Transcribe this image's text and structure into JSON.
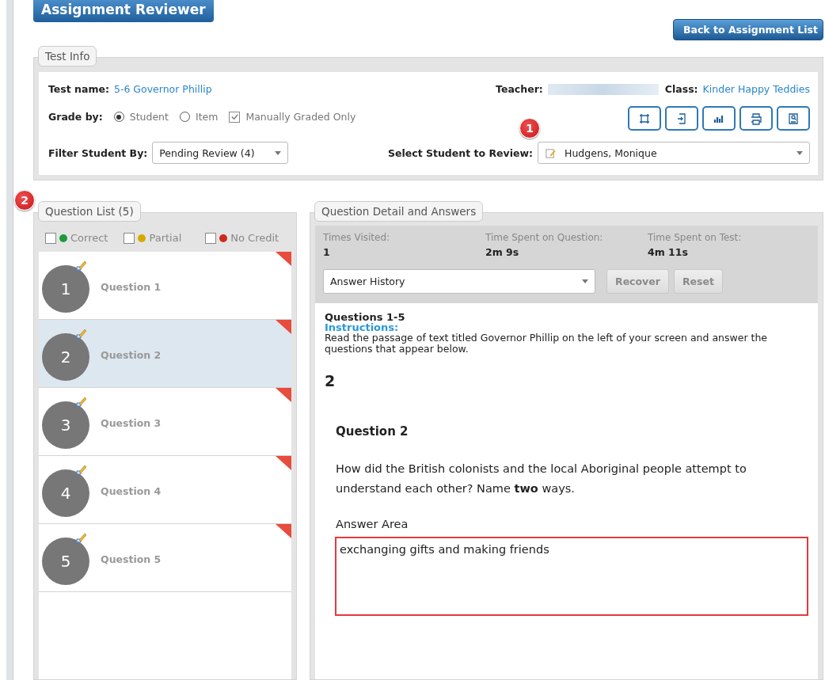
{
  "header": {
    "title": "Assignment Reviewer",
    "back_button": "Back to Assignment List"
  },
  "test_info": {
    "legend": "Test Info",
    "test_name_label": "Test name:",
    "test_name": "5-6 Governor Phillip",
    "teacher_label": "Teacher:",
    "class_label": "Class:",
    "class_name": "Kinder Happy Teddies",
    "grade_by_label": "Grade by:",
    "grade_by": [
      {
        "label": "Student",
        "selected": true
      },
      {
        "label": "Item",
        "selected": false
      }
    ],
    "manual_only": {
      "label": "Manually Graded Only",
      "checked": true
    },
    "filter_label": "Filter Student By:",
    "filter_value": "Pending Review (4)",
    "student_label": "Select Student to Review:",
    "student_value": "Hudgens, Monique",
    "callout": "1"
  },
  "question_list": {
    "legend": "Question List (5)",
    "callout": "2",
    "filters": [
      {
        "label": "Correct",
        "checked": false,
        "color": "#1e9a3a"
      },
      {
        "label": "Partial",
        "checked": false,
        "color": "#d9a800"
      },
      {
        "label": "No Credit",
        "checked": false,
        "color": "#d0281e"
      }
    ],
    "items": [
      {
        "number": "1",
        "label": "Question 1",
        "selected": false,
        "flagged": true
      },
      {
        "number": "2",
        "label": "Question 2",
        "selected": true,
        "flagged": true
      },
      {
        "number": "3",
        "label": "Question 3",
        "selected": false,
        "flagged": true
      },
      {
        "number": "4",
        "label": "Question 4",
        "selected": false,
        "flagged": true
      },
      {
        "number": "5",
        "label": "Question 5",
        "selected": false,
        "flagged": true
      }
    ]
  },
  "detail": {
    "legend": "Question Detail and Answers",
    "stats": [
      {
        "label": "Times Visited:",
        "value": "1"
      },
      {
        "label": "Time Spent on Question:",
        "value": "2m 9s"
      },
      {
        "label": "Time Spent on Test:",
        "value": "4m 11s"
      }
    ],
    "history": "Answer History",
    "buttons": [
      {
        "label": "Recover",
        "disabled": true
      },
      {
        "label": "Reset",
        "disabled": true
      }
    ],
    "section_title": "Questions 1-5",
    "instructions_label": "Instructions:",
    "instructions": "Read the passage of text titled Governor Phillip on the left of your screen and answer the questions that appear below.",
    "number": "2",
    "question_title": "Question 2",
    "question_text": "How did the British colonists and the local Aboriginal people attempt to understand each other? Name **two** ways.",
    "answer_label": "Answer Area",
    "answer": "exchanging gifts and making friends"
  }
}
